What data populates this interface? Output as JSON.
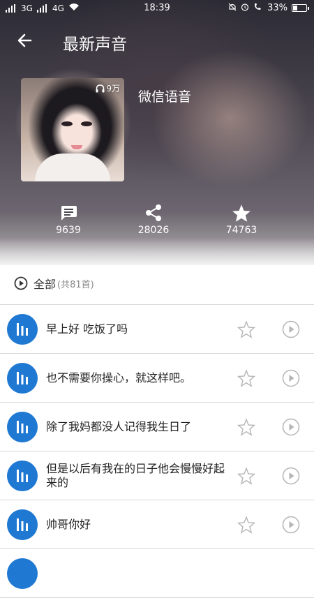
{
  "status_bar": {
    "signal1": "3G",
    "signal2": "4G",
    "time": "18:39",
    "battery": "33%"
  },
  "header": {
    "title": "最新声音"
  },
  "album": {
    "name": "微信语音",
    "play_count": "9万"
  },
  "stats": {
    "comments": "9639",
    "shares": "28026",
    "favorites": "74763"
  },
  "all_row": {
    "label": "全部",
    "count": "(共81首)"
  },
  "tracks": [
    {
      "title": "早上好 吃饭了吗"
    },
    {
      "title": "也不需要你操心，就这样吧。"
    },
    {
      "title": "除了我妈都没人记得我生日了"
    },
    {
      "title": "但是以后有我在的日子他会慢慢好起来的"
    },
    {
      "title": "帅哥你好"
    }
  ],
  "colors": {
    "accent": "#1f78d1",
    "divider": "#d8d8d8"
  }
}
